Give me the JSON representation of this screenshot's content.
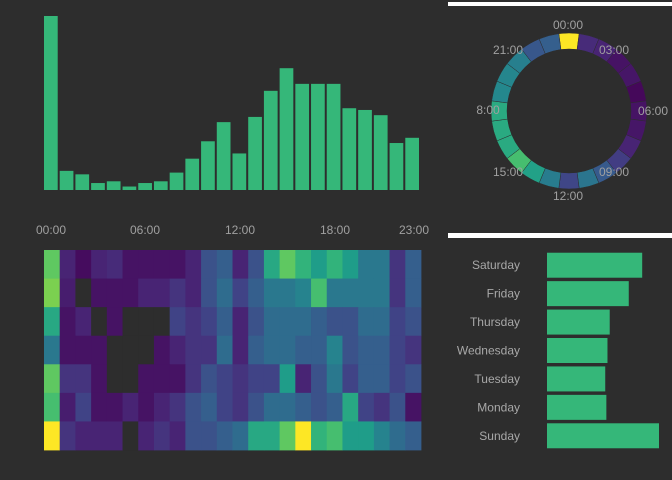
{
  "colors": {
    "background": "#2d2d2d",
    "bar": "#35b779",
    "divider": "#ffffff",
    "tick_text": "#a0a0a0"
  },
  "chart_data": [
    {
      "id": "hourly",
      "type": "bar",
      "title": "",
      "xlabel": "",
      "ylabel": "",
      "ylim": [
        0,
        100
      ],
      "categories": [
        "00:00",
        "01:00",
        "02:00",
        "03:00",
        "04:00",
        "05:00",
        "06:00",
        "07:00",
        "08:00",
        "09:00",
        "10:00",
        "11:00",
        "12:00",
        "13:00",
        "14:00",
        "15:00",
        "16:00",
        "17:00",
        "18:00",
        "19:00",
        "20:00",
        "21:00",
        "22:00",
        "23:00"
      ],
      "values": [
        100,
        11,
        9,
        4,
        5,
        2,
        4,
        5,
        10,
        18,
        28,
        39,
        21,
        42,
        57,
        70,
        61,
        61,
        61,
        47,
        46,
        43,
        27,
        30
      ],
      "tick_labels": [
        "00:00",
        "06:00",
        "12:00",
        "18:00",
        "23:00"
      ],
      "grid": false
    },
    {
      "id": "clock",
      "type": "pie",
      "title": "",
      "categories": [
        "00:00",
        "01:00",
        "02:00",
        "03:00",
        "04:00",
        "05:00",
        "06:00",
        "07:00",
        "08:00",
        "09:00",
        "10:00",
        "11:00",
        "12:00",
        "13:00",
        "14:00",
        "15:00",
        "16:00",
        "17:00",
        "18:00",
        "19:00",
        "20:00",
        "21:00",
        "22:00",
        "23:00"
      ],
      "values": [
        1,
        1,
        1,
        1,
        1,
        1,
        1,
        1,
        1,
        1,
        1,
        1,
        1,
        1,
        1,
        1,
        1,
        1,
        1,
        1,
        1,
        1,
        1,
        1
      ],
      "intensity": [
        1.0,
        0.12,
        0.1,
        0.05,
        0.06,
        0.02,
        0.05,
        0.06,
        0.1,
        0.18,
        0.28,
        0.39,
        0.21,
        0.42,
        0.57,
        0.7,
        0.61,
        0.61,
        0.61,
        0.47,
        0.46,
        0.43,
        0.27,
        0.3
      ],
      "tick_labels": [
        "00:00",
        "03:00",
        "06:00",
        "09:00",
        "12:00",
        "15:00",
        "8:00",
        "21:00"
      ]
    },
    {
      "id": "heatmap",
      "type": "heatmap",
      "title": "",
      "rows": [
        "Saturday",
        "Friday",
        "Thursday",
        "Wednesday",
        "Tuesday",
        "Monday",
        "Sunday"
      ],
      "columns": [
        "00:00",
        "01:00",
        "02:00",
        "03:00",
        "04:00",
        "05:00",
        "06:00",
        "07:00",
        "08:00",
        "09:00",
        "10:00",
        "11:00",
        "12:00",
        "13:00",
        "14:00",
        "15:00",
        "16:00",
        "17:00",
        "18:00",
        "19:00",
        "20:00",
        "21:00",
        "22:00",
        "23:00"
      ],
      "values": [
        [
          0.75,
          0.1,
          0.03,
          0.1,
          0.12,
          0.05,
          0.05,
          0.05,
          0.05,
          0.1,
          0.25,
          0.3,
          0.1,
          0.25,
          0.6,
          0.75,
          0.65,
          0.55,
          0.65,
          0.55,
          0.4,
          0.4,
          0.15,
          0.3
        ],
        [
          0.8,
          0.08,
          null,
          0.05,
          0.05,
          0.05,
          0.1,
          0.1,
          0.15,
          0.1,
          0.25,
          0.35,
          0.2,
          0.3,
          0.4,
          0.4,
          0.45,
          0.7,
          0.4,
          0.4,
          0.4,
          0.4,
          0.15,
          0.3
        ],
        [
          0.6,
          0.05,
          0.1,
          null,
          0.05,
          null,
          null,
          null,
          0.2,
          0.15,
          0.2,
          0.3,
          0.1,
          0.25,
          0.35,
          0.35,
          0.35,
          0.3,
          0.25,
          0.25,
          0.35,
          0.35,
          0.2,
          0.25
        ],
        [
          0.4,
          0.05,
          0.05,
          0.05,
          null,
          null,
          null,
          0.05,
          0.1,
          0.15,
          0.15,
          0.35,
          0.1,
          0.3,
          0.35,
          0.35,
          0.3,
          0.3,
          0.45,
          0.25,
          0.3,
          0.3,
          0.2,
          0.15
        ],
        [
          0.75,
          0.15,
          0.15,
          0.05,
          null,
          null,
          0.05,
          0.05,
          0.05,
          0.15,
          0.25,
          0.2,
          0.15,
          0.2,
          0.2,
          0.55,
          0.1,
          0.25,
          0.4,
          0.2,
          0.3,
          0.3,
          0.2,
          0.25
        ],
        [
          0.7,
          0.08,
          0.2,
          0.05,
          0.05,
          0.1,
          0.05,
          0.1,
          0.15,
          0.25,
          0.3,
          0.2,
          0.15,
          0.25,
          0.35,
          0.35,
          0.3,
          0.25,
          0.3,
          0.6,
          0.2,
          0.15,
          0.25,
          0.05
        ],
        [
          1.0,
          0.15,
          0.1,
          0.1,
          0.1,
          null,
          0.1,
          0.15,
          0.1,
          0.25,
          0.25,
          0.3,
          0.35,
          0.6,
          0.6,
          0.75,
          1.0,
          0.65,
          0.7,
          0.55,
          0.55,
          0.45,
          0.35,
          0.3
        ]
      ],
      "tick_labels": [
        "00:00",
        "06:00",
        "12:00",
        "18:00",
        "23:00"
      ]
    },
    {
      "id": "weekday",
      "type": "bar",
      "orientation": "horizontal",
      "title": "",
      "categories": [
        "Saturday",
        "Friday",
        "Thursday",
        "Wednesday",
        "Tuesday",
        "Monday",
        "Sunday"
      ],
      "values": [
        85,
        73,
        56,
        54,
        52,
        53,
        100
      ],
      "ylim": [
        0,
        100
      ]
    }
  ]
}
